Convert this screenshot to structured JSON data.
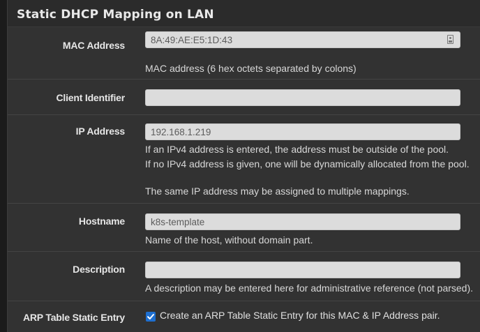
{
  "panel": {
    "title": "Static DHCP Mapping on LAN"
  },
  "fields": {
    "mac": {
      "label": "MAC Address",
      "value": "8A:49:AE:E5:1D:43",
      "help": "MAC address (6 hex octets separated by colons)",
      "icon": "id-card-icon"
    },
    "client_id": {
      "label": "Client Identifier",
      "value": ""
    },
    "ip": {
      "label": "IP Address",
      "value": "192.168.1.219",
      "help": [
        "If an IPv4 address is entered, the address must be outside of the pool.",
        "If no IPv4 address is given, one will be dynamically allocated from the pool.",
        "The same IP address may be assigned to multiple mappings."
      ]
    },
    "hostname": {
      "label": "Hostname",
      "value": "k8s-template",
      "help": "Name of the host, without domain part."
    },
    "description": {
      "label": "Description",
      "value": "",
      "help": "A description may be entered here for administrative reference (not parsed)."
    },
    "arp": {
      "label": "ARP Table Static Entry",
      "checked": true,
      "checkbox_label": "Create an ARP Table Static Entry for this MAC & IP Address pair."
    }
  },
  "colors": {
    "accent": "#1e6fd0",
    "panel_bg": "#323232",
    "field_bg": "#dcdcdc"
  }
}
